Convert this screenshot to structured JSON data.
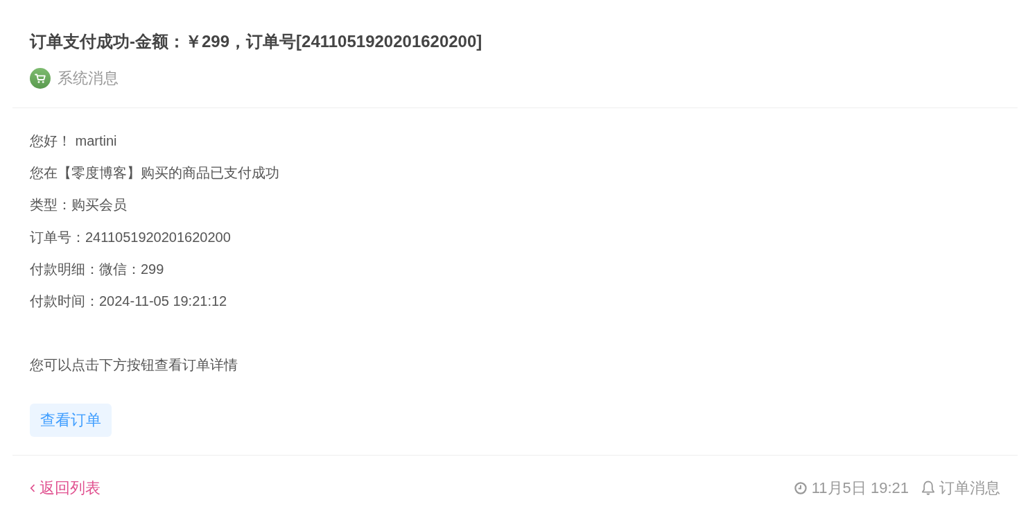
{
  "message": {
    "title": "订单支付成功-金额：￥299，订单号[2411051920201620200]",
    "source": "系统消息"
  },
  "body": {
    "paragraphs": [
      {
        "lines": [
          "您好！ martini",
          "您在【零度博客】购买的商品已支付成功",
          "类型：购买会员",
          "订单号：2411051920201620200",
          "付款明细：微信：299",
          "付款时间：2024-11-05 19:21:12"
        ]
      },
      {
        "lines": [
          "您可以点击下方按钮查看订单详情"
        ]
      }
    ],
    "button": "查看订单"
  },
  "footer": {
    "back_link": "返回列表",
    "time": "11月5日 19:21",
    "category": "订单消息"
  }
}
